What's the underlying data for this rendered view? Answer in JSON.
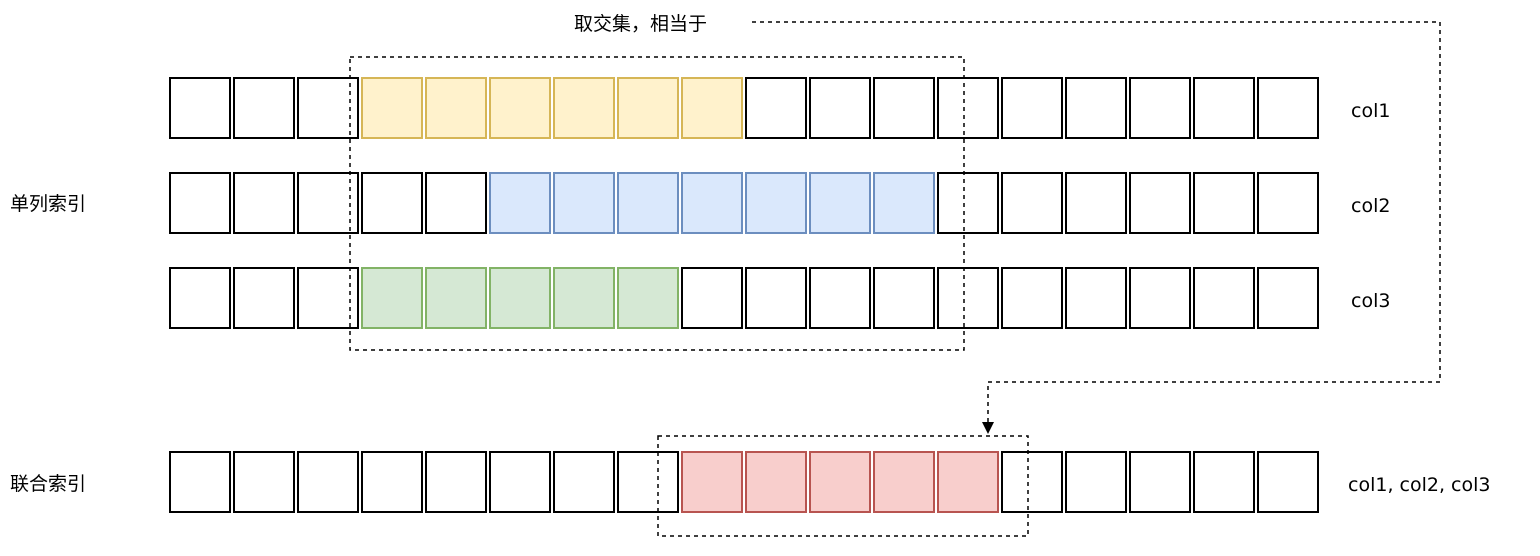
{
  "title_note": "取交集，相当于",
  "sections": {
    "single": "单列索引",
    "composite": "联合索引"
  },
  "cells_per_row": 18,
  "rows": [
    {
      "id": "col1",
      "label": "col1",
      "highlight": {
        "from": 3,
        "to": 8
      },
      "fill": "#fff2cc",
      "stroke": "#d6b656"
    },
    {
      "id": "col2",
      "label": "col2",
      "highlight": {
        "from": 5,
        "to": 11
      },
      "fill": "#dae8fc",
      "stroke": "#6c8ebf"
    },
    {
      "id": "col3",
      "label": "col3",
      "highlight": {
        "from": 3,
        "to": 7
      },
      "fill": "#d5e8d4",
      "stroke": "#82b366"
    },
    {
      "id": "combined",
      "label": "col1, col2, col3",
      "highlight": {
        "from": 8,
        "to": 12
      },
      "fill": "#f8cecc",
      "stroke": "#b85450"
    }
  ]
}
